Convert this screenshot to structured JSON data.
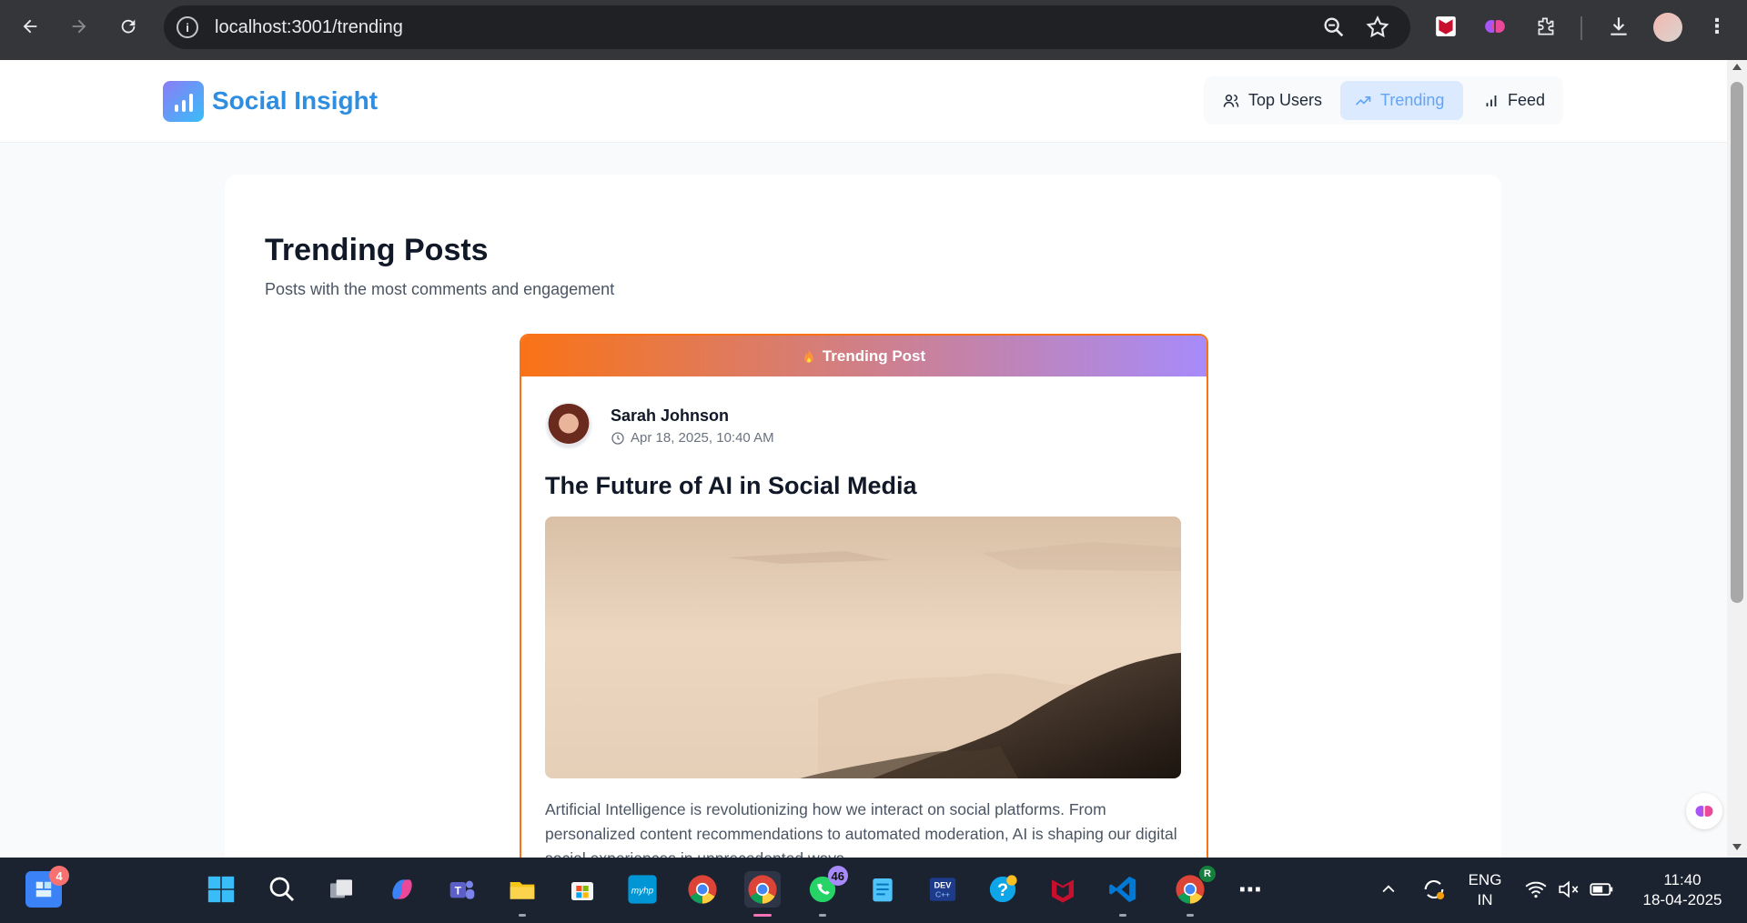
{
  "browser": {
    "url": "localhost:3001/trending"
  },
  "app": {
    "brand": "Social Insight",
    "nav": [
      {
        "label": "Top Users",
        "icon": "users-icon"
      },
      {
        "label": "Trending",
        "icon": "trending-up-icon",
        "active": true
      },
      {
        "label": "Feed",
        "icon": "bar-chart-icon"
      }
    ]
  },
  "page": {
    "title": "Trending Posts",
    "subtitle": "Posts with the most comments and engagement"
  },
  "post": {
    "banner": "Trending Post",
    "author": "Sarah Johnson",
    "date": "Apr 18, 2025, 10:40 AM",
    "title": "The Future of AI in Social Media",
    "body": "Artificial Intelligence is revolutionizing how we interact on social platforms. From personalized content recommendations to automated moderation, AI is shaping our digital social experiences in unprecedented ways."
  },
  "taskbar": {
    "badges": {
      "widgets": "4",
      "whatsapp": "46",
      "chrome_profile": "R"
    },
    "lang_top": "ENG",
    "lang_bottom": "IN",
    "time": "11:40",
    "date": "18-04-2025"
  },
  "colors": {
    "accent": "#60a5fa",
    "brand": "#2f8ee0",
    "post_border": "#f97316",
    "taskbar": "#1b2230"
  }
}
